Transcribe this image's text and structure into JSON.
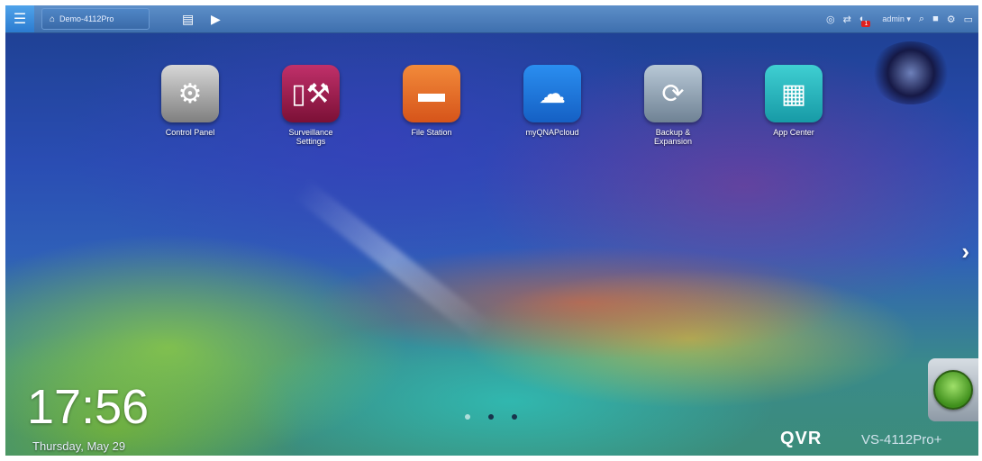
{
  "topbar": {
    "menu_icon": "hamburger-icon",
    "tab_label": "Demo-4112Pro",
    "user": "admin",
    "notification_count": "1",
    "icons": [
      "refresh-icon",
      "sync-icon",
      "notification-icon",
      "search-icon",
      "info-icon",
      "options-icon",
      "monitor-icon"
    ]
  },
  "apps": [
    {
      "label": "Control Panel",
      "icon": "gear-icon"
    },
    {
      "label": "Surveillance\nSettings",
      "icon": "surveillance-icon"
    },
    {
      "label": "File Station",
      "icon": "folder-icon"
    },
    {
      "label": "myQNAPcloud",
      "icon": "cloud-icon"
    },
    {
      "label": "Backup &\nExpansion",
      "icon": "backup-icon"
    },
    {
      "label": "App Center",
      "icon": "app-grid-icon"
    }
  ],
  "clock": {
    "time": "17:56",
    "date": "Thursday, May 29"
  },
  "footer": {
    "brand": "QVR",
    "model": "VS-4112Pro+"
  },
  "pager": {
    "pages": 3,
    "active": 1
  }
}
